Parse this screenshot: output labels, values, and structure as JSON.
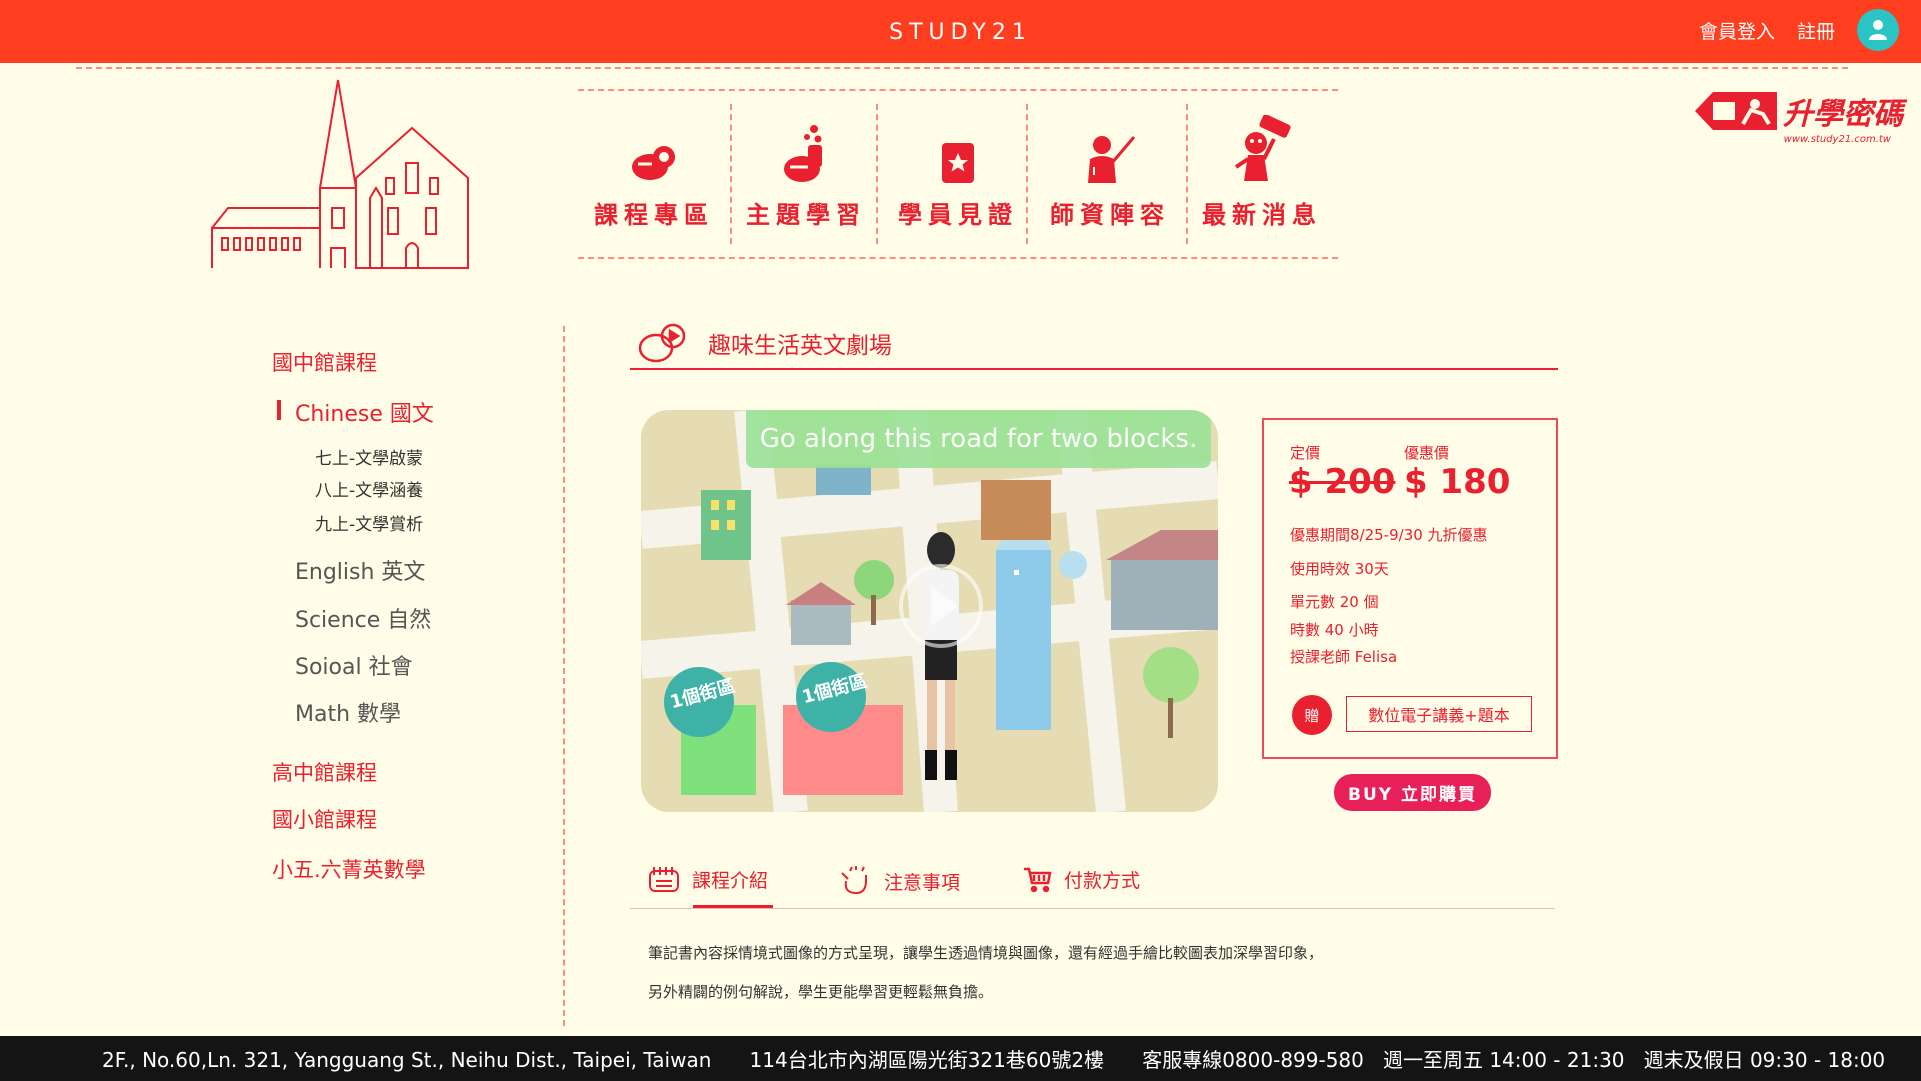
{
  "header": {
    "brand": "STUDY21",
    "login": "會員登入",
    "register": "註冊"
  },
  "nav": [
    {
      "label": "課程專區",
      "icon": "video-camera-icon"
    },
    {
      "label": "主題學習",
      "icon": "chemistry-hand-icon"
    },
    {
      "label": "學員見證",
      "icon": "certificate-icon"
    },
    {
      "label": "師資陣容",
      "icon": "teacher-icon"
    },
    {
      "label": "最新消息",
      "icon": "news-mascot-icon"
    }
  ],
  "logo": {
    "text": "升學密碼",
    "url": "www.study21.com.tw"
  },
  "sidebar": {
    "cat1": "國中館課程",
    "chinese": "Chinese 國文",
    "chinese_items": [
      "七上-文學啟蒙",
      "八上-文學涵養",
      "九上-文學賞析"
    ],
    "english": "English 英文",
    "science": "Science 自然",
    "social": "Soioal 社會",
    "math": "Math 數學",
    "cat2": "高中館課程",
    "cat3": "國小館課程",
    "cat4": "小五.六菁英數學"
  },
  "course": {
    "title": "趣味生活英文劇場",
    "video_caption": "Go along this road for two blocks.",
    "block_label": "1個街區"
  },
  "pricing": {
    "orig_label": "定價",
    "sale_label": "優惠價",
    "orig_price": "$ 200",
    "sale_price": "$ 180",
    "promo": "優惠期間8/25-9/30  九折優惠",
    "validity": "使用時效   30天",
    "units": "單元數   20 個",
    "hours": "時數  40 小時",
    "teacher": "授課老師  Felisa",
    "gift_badge": "贈",
    "gift_item": "數位電子講義+題本",
    "buy": "BUY 立即購買"
  },
  "tabs": [
    {
      "label": "課程介紹",
      "icon": "notebook-icon"
    },
    {
      "label": "注意事項",
      "icon": "waving-hand-icon"
    },
    {
      "label": "付款方式",
      "icon": "shopping-cart-icon"
    }
  ],
  "description": [
    "筆記書內容採情境式圖像的方式呈現，讓學生透過情境與圖像，還有經過手繪比較圖表加深學習印象，",
    "另外精闢的例句解說，學生更能學習更輕鬆無負擔。"
  ],
  "footer": {
    "text": "2F., No.60,Ln. 321, Yangguang St., Neihu Dist., Taipei, Taiwan      114台北市內湖區陽光街321巷60號2樓      客服專線0800-899-580   週一至周五 14:00 - 21:30   週末及假日 09:30 - 18:00"
  },
  "colors": {
    "topbar": "#ff3d1f",
    "accent": "#e8202f",
    "background": "#fffde7",
    "buy": "#e8205a",
    "footer": "#141414"
  }
}
